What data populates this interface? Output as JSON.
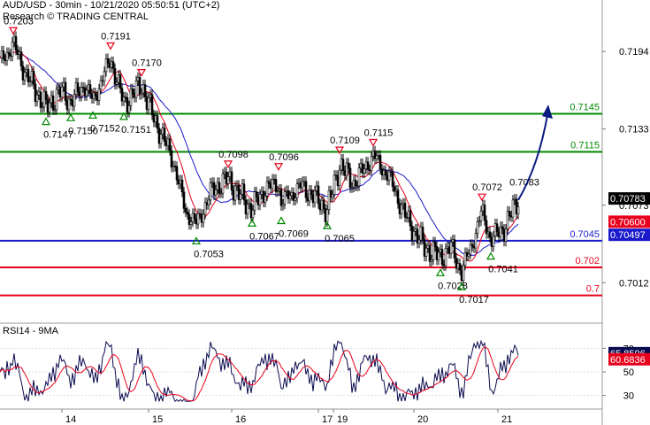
{
  "header": {
    "title": "AUD/USD - 30min - 10/21/2020 05:50:51 (UTC+2)",
    "source": "Research © TRADING CENTRAL"
  },
  "chart_data": [
    {
      "type": "line",
      "subtype": "candlestick with moving averages and support/resistance levels",
      "x_tick_labels": [
        "14",
        "15",
        "16",
        "17",
        "19",
        "20",
        "21"
      ],
      "ylim": [
        0.6985,
        0.7222
      ],
      "y_tick_labels": [
        "0.7194",
        "0.7133",
        "0.7073",
        "0.7012"
      ],
      "last_price": {
        "label": "0.70783",
        "value": 0.70783,
        "color": "#000000"
      },
      "ma_tags": [
        {
          "label": "0.70600",
          "value": 0.706,
          "color": "#e8001c"
        },
        {
          "label": "0.70497",
          "value": 0.70497,
          "color": "#1a1acc"
        }
      ],
      "levels": [
        {
          "value": 0.7145,
          "label": "0.7145",
          "color": "#008800"
        },
        {
          "value": 0.7115,
          "label": "0.7115",
          "color": "#008800"
        },
        {
          "value": 0.7045,
          "label": "0.7045",
          "color": "#1a1acc"
        },
        {
          "value": 0.7024,
          "label": "0.702",
          "color": "#e8001c"
        },
        {
          "value": 0.7002,
          "label": "0.7",
          "color": "#e8001c"
        }
      ],
      "swing_points": [
        {
          "t": 15,
          "value": 0.7203,
          "kind": "high",
          "label": "0.7203"
        },
        {
          "t": 52,
          "value": 0.7147,
          "kind": "low",
          "label": "0.7147"
        },
        {
          "t": 80,
          "value": 0.715,
          "kind": "low",
          "label": "0.7150"
        },
        {
          "t": 105,
          "value": 0.7152,
          "kind": "low",
          "label": "0.7152"
        },
        {
          "t": 125,
          "value": 0.7191,
          "kind": "high",
          "label": "0.7191"
        },
        {
          "t": 140,
          "value": 0.7151,
          "kind": "low",
          "label": "0.7151"
        },
        {
          "t": 160,
          "value": 0.717,
          "kind": "high",
          "label": "0.7170"
        },
        {
          "t": 222,
          "value": 0.7053,
          "kind": "low",
          "label": "0.7053"
        },
        {
          "t": 258,
          "value": 0.7098,
          "kind": "high",
          "label": "0.7098"
        },
        {
          "t": 285,
          "value": 0.7067,
          "kind": "low",
          "label": "0.7067"
        },
        {
          "t": 315,
          "value": 0.7096,
          "kind": "high",
          "label": "0.7096"
        },
        {
          "t": 318,
          "value": 0.7069,
          "kind": "low",
          "label": "0.7069"
        },
        {
          "t": 370,
          "value": 0.7065,
          "kind": "low",
          "label": "0.7065"
        },
        {
          "t": 384,
          "value": 0.7109,
          "kind": "high",
          "label": "0.7109"
        },
        {
          "t": 422,
          "value": 0.7115,
          "kind": "high",
          "label": "0.7115"
        },
        {
          "t": 498,
          "value": 0.7028,
          "kind": "low",
          "label": "0.7028"
        },
        {
          "t": 522,
          "value": 0.7017,
          "kind": "low",
          "label": "0.7017"
        },
        {
          "t": 545,
          "value": 0.7072,
          "kind": "high",
          "label": "0.7072"
        },
        {
          "t": 555,
          "value": 0.7041,
          "kind": "low",
          "label": "0.7041"
        }
      ],
      "target_label": "0.7083",
      "projection": {
        "from": [
          586,
          0.7077
        ],
        "to": [
          620,
          0.7148
        ]
      }
    },
    {
      "type": "line",
      "title": "RSI14 - 9MA",
      "x_tick_labels": [
        "14",
        "15",
        "16",
        "17",
        "19",
        "20",
        "21"
      ],
      "ylim": [
        20,
        80
      ],
      "y_tick_labels": [
        "70",
        "50",
        "30"
      ],
      "series": [
        {
          "name": "RSI14",
          "value": 65.8596,
          "label": "65.8596",
          "color": "#0a0a50"
        },
        {
          "name": "9MA",
          "value": 60.6836,
          "label": "60.6836",
          "color": "#e8001c"
        }
      ]
    }
  ]
}
